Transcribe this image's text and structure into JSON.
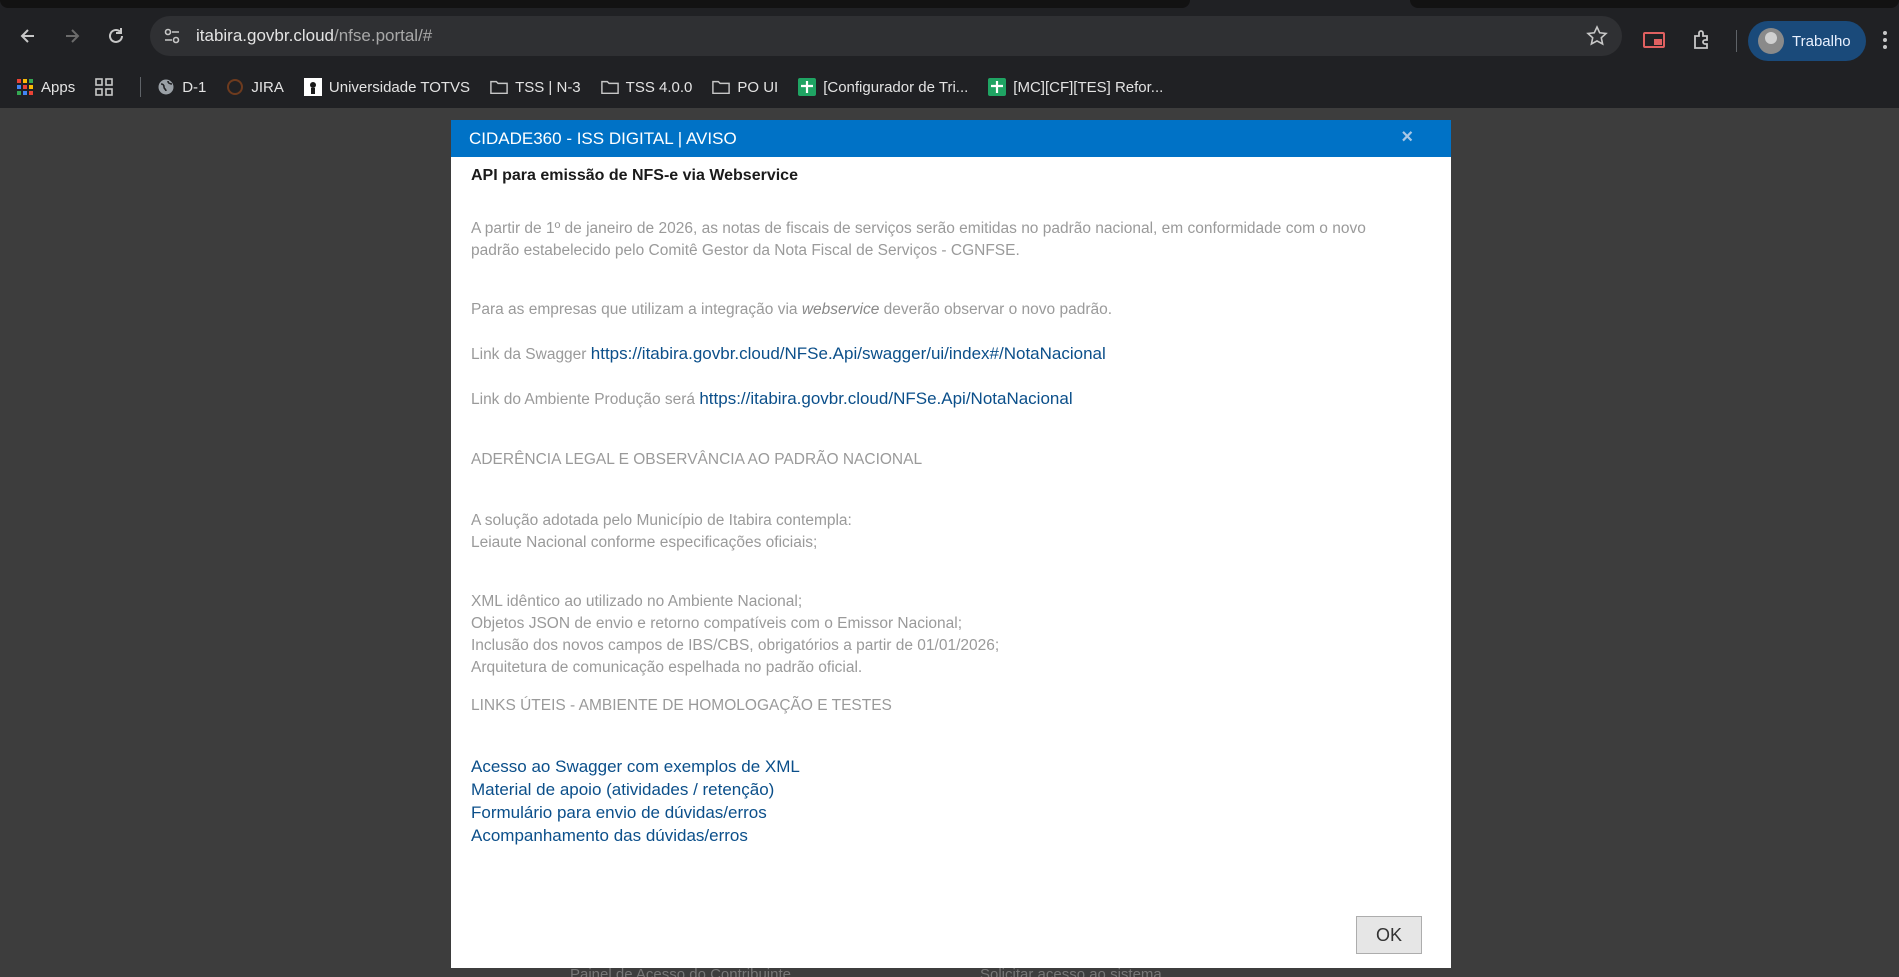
{
  "browser": {
    "url_host": "itabira.govbr.cloud",
    "url_path": "/nfse.portal/#",
    "profile_label": "Trabalho",
    "bookmarks": [
      {
        "label": "Apps",
        "icon": "apps-grid-icon"
      },
      {
        "label": "D-1",
        "icon": "globe-icon"
      },
      {
        "label": "JIRA",
        "icon": "jira-icon"
      },
      {
        "label": "Universidade TOTVS",
        "icon": "totvs-icon"
      },
      {
        "label": "TSS | N-3",
        "icon": "folder-icon"
      },
      {
        "label": "TSS 4.0.0",
        "icon": "folder-icon"
      },
      {
        "label": "PO UI",
        "icon": "folder-icon"
      },
      {
        "label": "[Configurador de Tri...",
        "icon": "sheets-icon"
      },
      {
        "label": "[MC][CF][TES] Refor...",
        "icon": "sheets-icon"
      }
    ]
  },
  "modal": {
    "title": "CIDADE360 - ISS DIGITAL | AVISO",
    "close_glyph": "×",
    "heading": "API para emissão de NFS-e via Webservice",
    "para1_line1": "A partir de 1º de janeiro de 2026, as notas de fiscais de serviços serão emitidas no padrão nacional, em conformidade com o novo",
    "para1_line2": "padrão estabelecido pelo Comitê Gestor da Nota Fiscal de Serviços - CGNFSE.",
    "para2_before": "Para as empresas que utilizam a integração  via ",
    "para2_em": "webservice",
    "para2_after": " deverão observar o novo padrão.",
    "swagger_label": "Link da Swagger ",
    "swagger_url": "https://itabira.govbr.cloud/NFSe.Api/swagger/ui/index#/NotaNacional",
    "prod_label": "Link do Ambiente Produção será ",
    "prod_url": "https://itabira.govbr.cloud/NFSe.Api/NotaNacional",
    "section1": "ADERÊNCIA LEGAL E OBSERVÂNCIA AO PADRÃO NACIONAL",
    "solution_line1": "A solução adotada pelo Município de Itabira contempla:",
    "solution_line2": "Leiaute Nacional conforme especificações oficiais;",
    "list": [
      "XML idêntico ao utilizado no Ambiente Nacional;",
      "Objetos JSON de envio e retorno compatíveis com o Emissor Nacional;",
      "Inclusão dos novos campos de IBS/CBS, obrigatórios a partir de 01/01/2026;",
      "Arquitetura de comunicação espelhada no padrão oficial."
    ],
    "section2": "LINKS ÚTEIS - AMBIENTE DE HOMOLOGAÇÃO E TESTES",
    "links": [
      "Acesso ao Swagger com exemplos de XML",
      "Material de apoio (atividades / retenção)",
      "Formulário para envio de dúvidas/erros",
      "Acompanhamento das dúvidas/erros"
    ],
    "ok_label": "OK"
  },
  "background": {
    "hint_left": "Painel de Acesso do Contribuinte",
    "hint_right": "Solicitar acesso ao sistema"
  }
}
